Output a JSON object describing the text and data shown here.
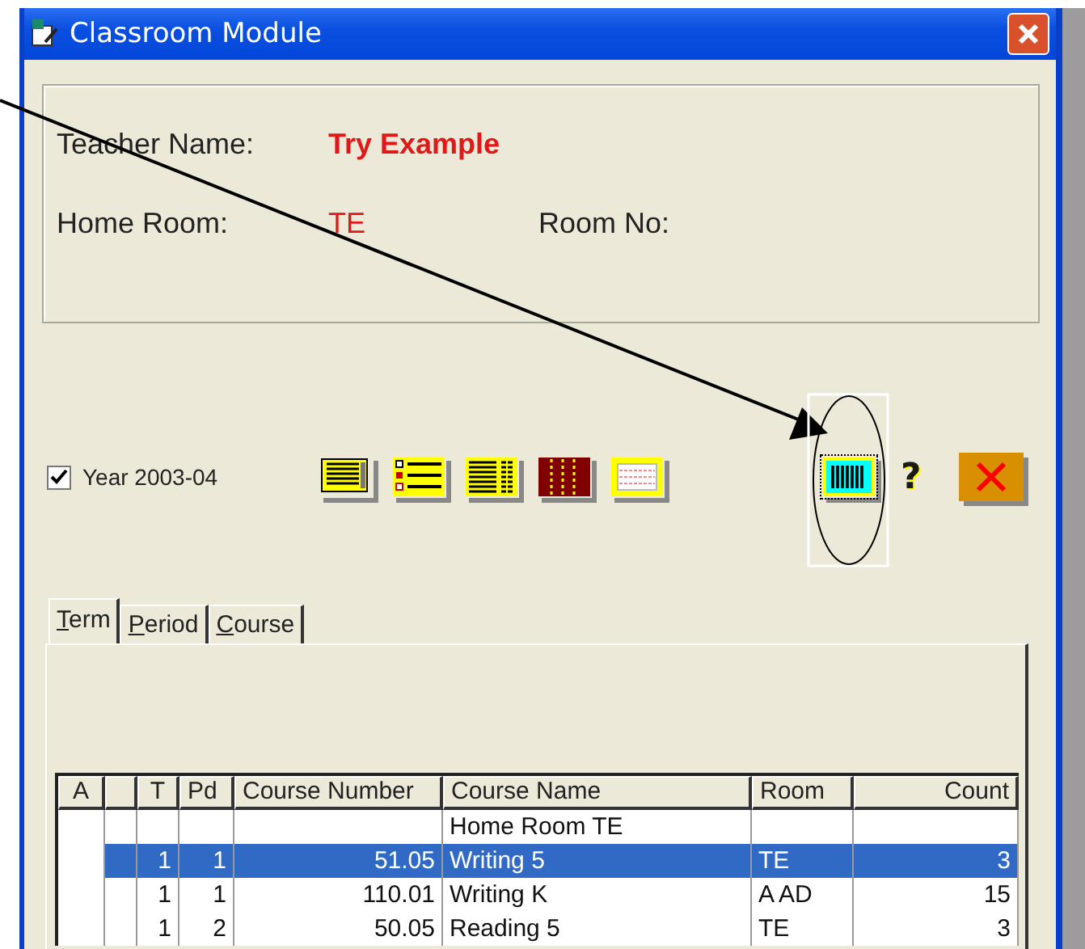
{
  "window": {
    "title": "Classroom Module"
  },
  "teacher": {
    "name_label": "Teacher Name:",
    "name": "Try Example",
    "home_room_label": "Home Room:",
    "home_room": "TE",
    "room_no_label": "Room No:"
  },
  "toolbar": {
    "year": {
      "label": "Year 2003-04",
      "checked": true
    },
    "buttons": [
      {
        "kind": "page",
        "selected": false
      },
      {
        "kind": "list",
        "selected": false
      },
      {
        "kind": "columns",
        "selected": false
      },
      {
        "kind": "bars",
        "selected": false
      },
      {
        "kind": "grid",
        "selected": false
      },
      {
        "kind": "barcode",
        "selected": true
      }
    ],
    "help": "?"
  },
  "tabs": [
    {
      "label": "Term",
      "selected": true
    },
    {
      "label": "Period",
      "selected": false
    },
    {
      "label": "Course",
      "selected": false
    }
  ],
  "table": {
    "columns": [
      "A",
      "T",
      "Pd",
      "Course Number",
      "Course Name",
      "Room",
      "Count"
    ],
    "rows": [
      {
        "course_name": "Home Room TE",
        "selected": false
      },
      {
        "t": "1",
        "pd": "1",
        "course_number": "51.05",
        "course_name": "Writing 5",
        "room": "TE",
        "count": "3",
        "selected": true
      },
      {
        "t": "1",
        "pd": "1",
        "course_number": "110.01",
        "course_name": "Writing K",
        "room": "A AD",
        "count": "15",
        "selected": false
      },
      {
        "t": "1",
        "pd": "2",
        "course_number": "50.05",
        "course_name": "Reading 5",
        "room": "TE",
        "count": "3",
        "selected": false
      }
    ]
  }
}
